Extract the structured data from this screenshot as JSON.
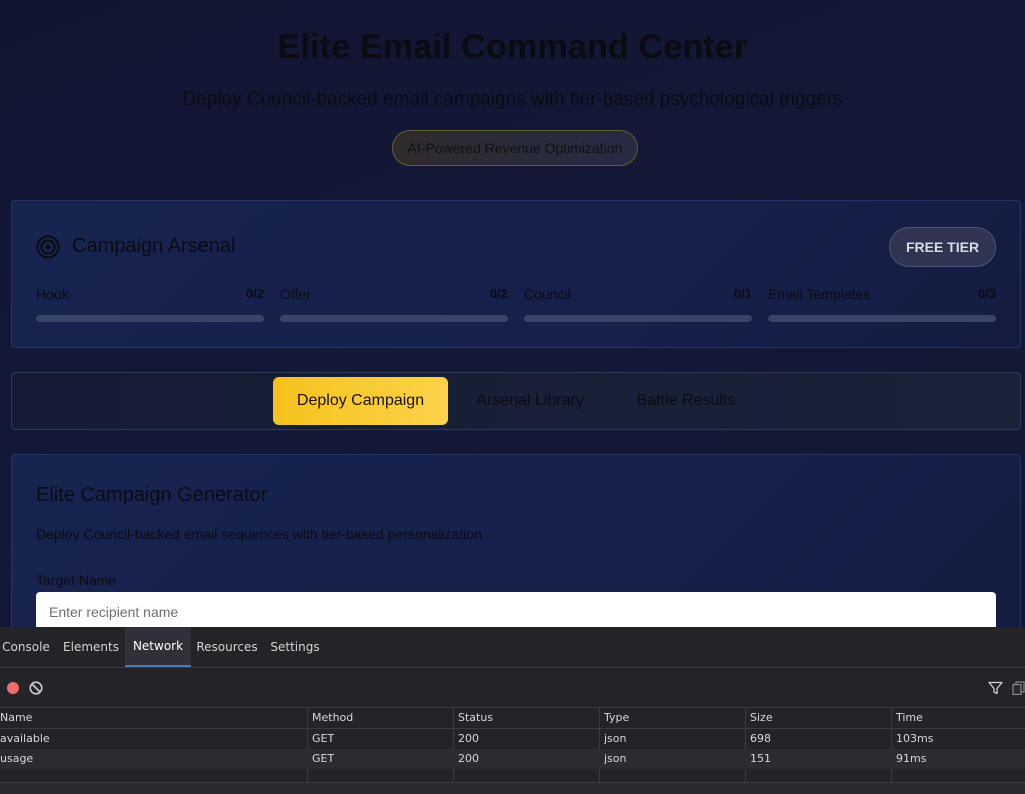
{
  "hero": {
    "title": "Elite Email Command Center",
    "subtitle": "Deploy Council-backed email campaigns with tier-based psychological triggers",
    "badge": "AI-Powered Revenue Optimization"
  },
  "arsenal": {
    "title": "Campaign Arsenal",
    "icon": "target-icon",
    "tier_label": "FREE TIER",
    "stats": [
      {
        "label": "Hook",
        "count": "0/2",
        "progress": 0
      },
      {
        "label": "Offer",
        "count": "0/2",
        "progress": 0
      },
      {
        "label": "Council",
        "count": "0/1",
        "progress": 0
      },
      {
        "label": "Email Templates",
        "count": "0/3",
        "progress": 0
      }
    ]
  },
  "tabs": [
    {
      "label": "Deploy Campaign",
      "active": true
    },
    {
      "label": "Arsenal Library",
      "active": false
    },
    {
      "label": "Battle Results",
      "active": false
    }
  ],
  "generator": {
    "title": "Elite Campaign Generator",
    "description": "Deploy Council-backed email sequences with tier-based personalization",
    "target_label": "Target Name",
    "target_placeholder": "Enter recipient name",
    "target_value": ""
  },
  "devtools": {
    "tabs": [
      {
        "label": "Console",
        "active": false
      },
      {
        "label": "Elements",
        "active": false
      },
      {
        "label": "Network",
        "active": true
      },
      {
        "label": "Resources",
        "active": false
      },
      {
        "label": "Settings",
        "active": false
      }
    ],
    "columns": [
      "Name",
      "Method",
      "Status",
      "Type",
      "Size",
      "Time"
    ],
    "rows": [
      {
        "name": "available",
        "method": "GET",
        "status": "200",
        "type": "json",
        "size": "698",
        "time": "103ms"
      },
      {
        "name": "usage",
        "method": "GET",
        "status": "200",
        "type": "json",
        "size": "151",
        "time": "91ms"
      }
    ]
  },
  "colors": {
    "accent": "#f6c21c",
    "page_bg": "#131735",
    "card_bg": "#172450",
    "record_red": "#f06c6c",
    "active_tab_underline": "#4a78c2"
  }
}
